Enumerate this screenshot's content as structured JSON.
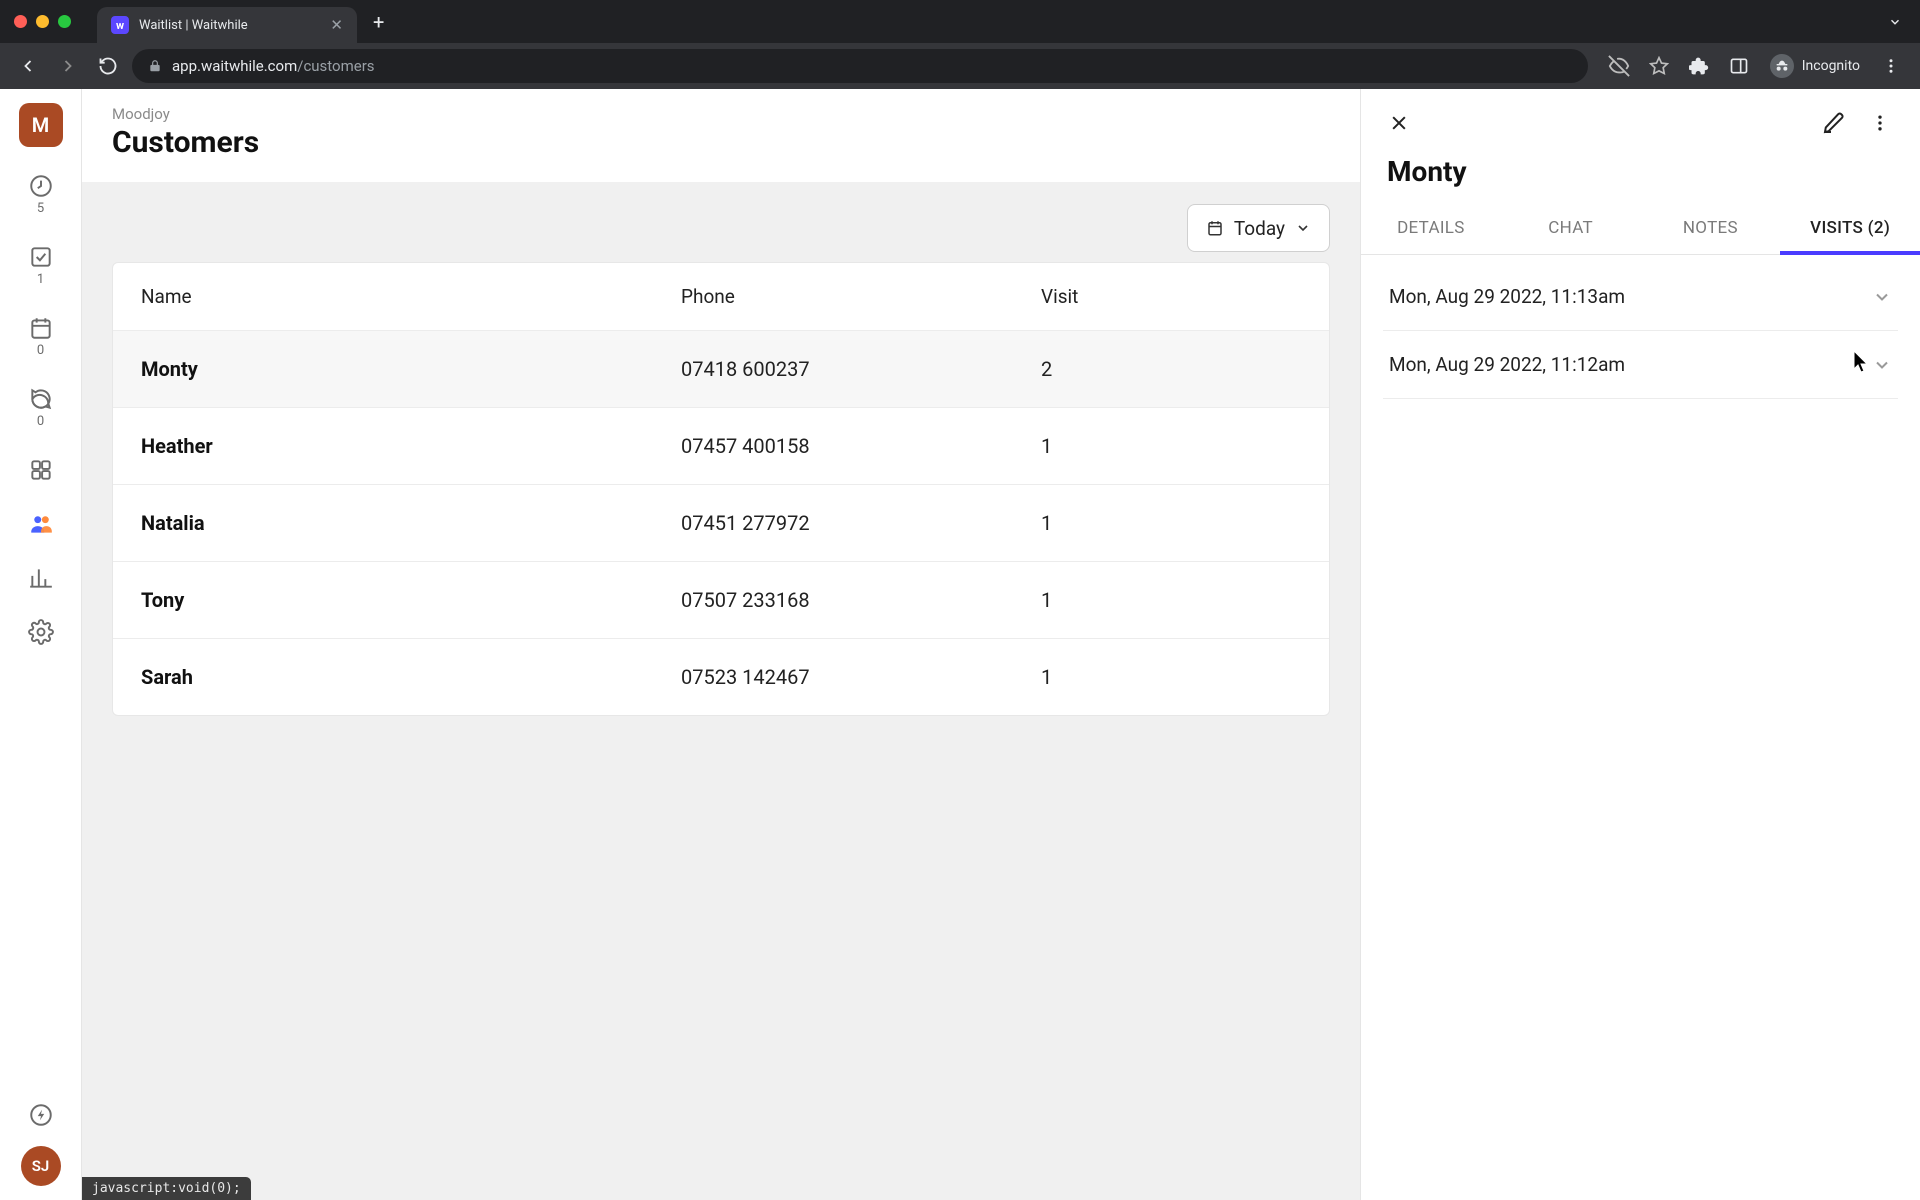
{
  "chrome": {
    "tab_title": "Waitlist | Waitwhile",
    "url_domain": "app.waitwhile.com",
    "url_path": "/customers",
    "incognito_label": "Incognito",
    "status_bar": "javascript:void(0);"
  },
  "sidebar": {
    "workspace_initial": "M",
    "counts": {
      "waitlist": "5",
      "served": "1",
      "calendar": "0",
      "messages": "0"
    },
    "user_initials": "SJ"
  },
  "header": {
    "breadcrumb": "Moodjoy",
    "title": "Customers"
  },
  "controls": {
    "today_label": "Today"
  },
  "table": {
    "columns": {
      "name": "Name",
      "phone": "Phone",
      "visit": "Visit"
    },
    "rows": [
      {
        "name": "Monty",
        "phone": "07418 600237",
        "visit": "2",
        "selected": true
      },
      {
        "name": "Heather",
        "phone": "07457 400158",
        "visit": "1",
        "selected": false
      },
      {
        "name": "Natalia",
        "phone": "07451 277972",
        "visit": "1",
        "selected": false
      },
      {
        "name": "Tony",
        "phone": "07507 233168",
        "visit": "1",
        "selected": false
      },
      {
        "name": "Sarah",
        "phone": "07523 142467",
        "visit": "1",
        "selected": false
      }
    ]
  },
  "panel": {
    "title": "Monty",
    "tabs": {
      "details": "DETAILS",
      "chat": "CHAT",
      "notes": "NOTES",
      "visits": "VISITS (2)"
    },
    "visits": [
      {
        "label": "Mon, Aug 29 2022, 11:13am"
      },
      {
        "label": "Mon, Aug 29 2022, 11:12am"
      }
    ]
  }
}
